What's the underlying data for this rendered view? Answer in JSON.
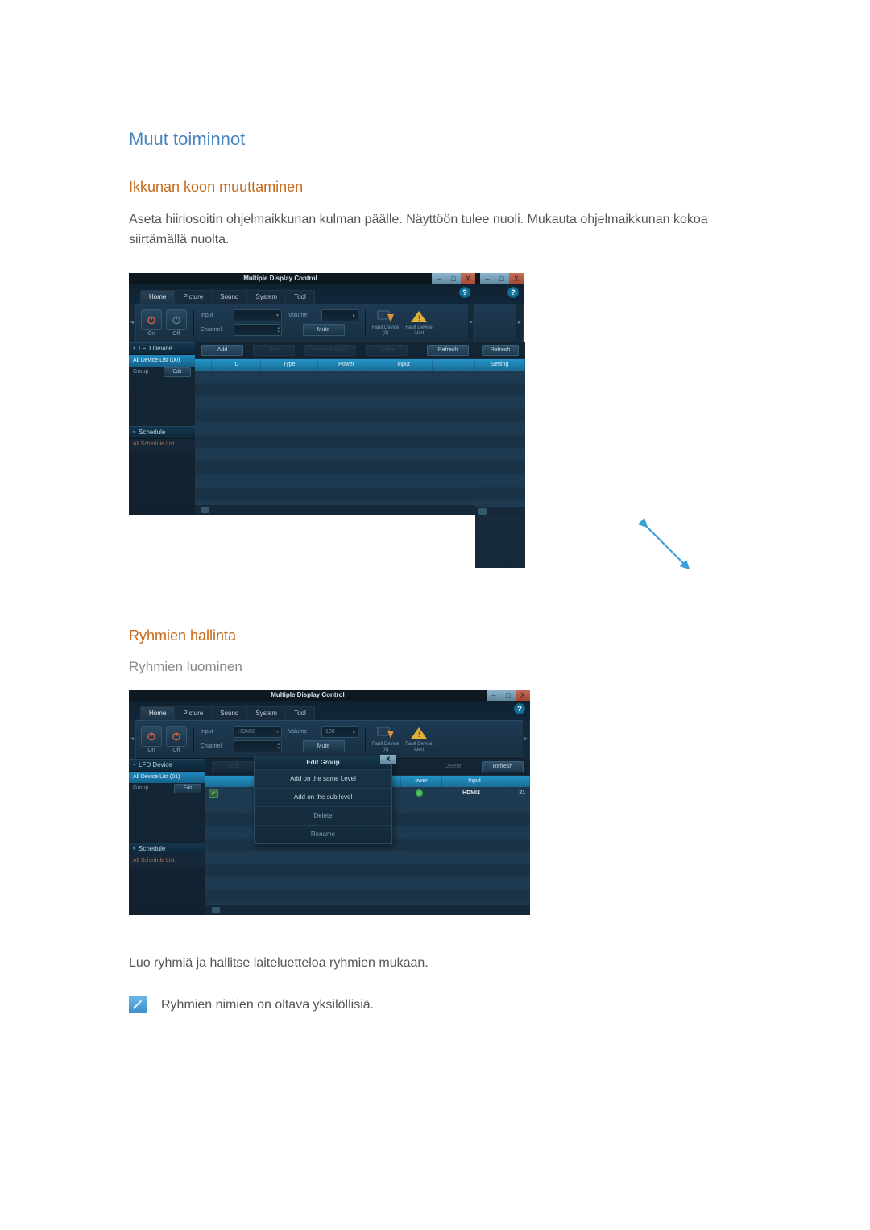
{
  "headings": {
    "h1": "Muut toiminnot",
    "h2a": "Ikkunan koon muuttaminen",
    "h2b": "Ryhmien hallinta",
    "h3": "Ryhmien luominen"
  },
  "paragraphs": {
    "resize": "Aseta hiiriosoitin ohjelmaikkunan kulman päälle. Näyttöön tulee nuoli. Mukauta ohjelmaikkunan kokoa siirtämällä nuolta.",
    "groups": "Luo ryhmiä ja hallitse laiteluetteloa ryhmien mukaan.",
    "note": "Ryhmien nimien on oltava yksilöllisiä."
  },
  "app": {
    "title": "Multiple Display Control",
    "tabs": {
      "home": "Home",
      "picture": "Picture",
      "sound": "Sound",
      "system": "System",
      "tool": "Tool"
    },
    "help": "?",
    "winctrl": {
      "min": "–",
      "max": "□",
      "close": "X"
    },
    "toolbar": {
      "on": "On",
      "off": "Off",
      "input": "Input",
      "input_val": "HDMI2",
      "channel": "Channel",
      "volume": "Volume",
      "volume_val": "100",
      "mute": "Mute",
      "fault0": "Fault Device\n(0)",
      "faultAlert": "Fault Device\nAlert"
    },
    "sidebar": {
      "lfd": "LFD Device",
      "all": "All Device List (00)",
      "all2": "All Device List (01)",
      "group": "Group",
      "edit": "Edit",
      "schedule": "Schedule",
      "all_schedule": "All Schedule List"
    },
    "actions": {
      "add": "Add",
      "edit": "Edit",
      "move": "Move & Copy",
      "delete": "Delete",
      "refresh": "Refresh"
    },
    "columns": {
      "id": "ID",
      "type": "Type",
      "power": "Power",
      "input": "Input",
      "setting": "Setting"
    },
    "columns2": {
      "power": "ower",
      "input": "Input"
    },
    "row": {
      "input": "HDMI2",
      "num": "21"
    },
    "popup": {
      "title": "Edit Group",
      "close": "X",
      "add_same": "Add on the same Level",
      "add_sub": "Add on the sub level",
      "delete": "Delete",
      "rename": "Rename"
    }
  }
}
